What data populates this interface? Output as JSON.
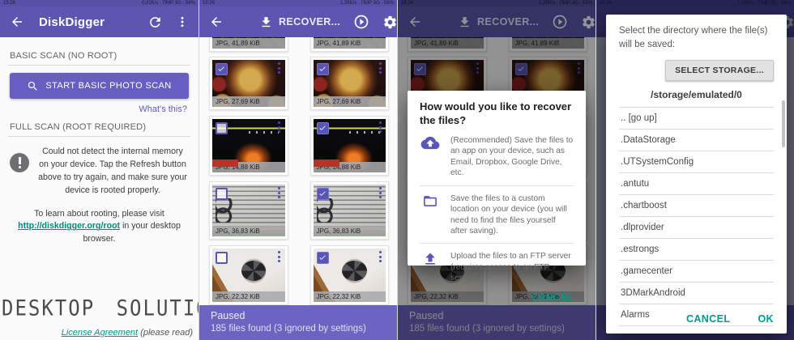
{
  "status": {
    "time": "15:26",
    "right_main": "0,02K/s · ПМР 3G · 58%",
    "right_gallery": "1,35K/s · ПМР 3G · 58%"
  },
  "main_screen": {
    "title": "DiskDigger",
    "basic_header": "BASIC SCAN (NO ROOT)",
    "scan_button": "START BASIC PHOTO SCAN",
    "whats_this": "What's this?",
    "full_header": "FULL SCAN (ROOT REQUIRED)",
    "root_error": "Could not detect the internal memory on your device. Tap the Refresh button above to try again, and make sure your device is rooted properly.",
    "root_info_prefix": "To learn about rooting, please visit ",
    "root_link": "http://diskdigger.org/root",
    "root_info_suffix": " in your desktop browser.",
    "watermark": "DESKTOP SOLUTION",
    "license_link": "License Agreement",
    "license_note": "(please read)"
  },
  "gallery": {
    "recover_label": "RECOVER...",
    "partial_caption": "JPG, 41,89 KiB",
    "rows": [
      {
        "kind": "pizza",
        "caption": "JPG, 27,69 KiB",
        "left_checked": true,
        "right_checked": true
      },
      {
        "kind": "concert",
        "caption": "JPG, 14,88 KiB",
        "left_checked": false,
        "right_checked": true
      },
      {
        "kind": "label",
        "caption": "JPG, 36,83 KiB",
        "left_checked": false,
        "right_checked": true
      },
      {
        "kind": "fan",
        "caption": "JPG, 22,32 KiB",
        "left_checked": false,
        "right_checked": true
      }
    ],
    "status_line1": "Paused",
    "status_line2": "185 files found (3 ignored by settings)"
  },
  "recover_dialog": {
    "title": "How would you like to recover the files?",
    "options": [
      {
        "icon": "cloud-upload-icon",
        "text": "(Recommended) Save the files to an app on your device, such as Email, Dropbox, Google Drive, etc."
      },
      {
        "icon": "folder-icon",
        "text": "Save the files to a custom location on your device (you will need to find the files yourself after saving)."
      },
      {
        "icon": "ftp-upload-icon",
        "text": "Upload the files to an FTP server (requires access to an FTP server)."
      }
    ],
    "cancel": "CANCEL"
  },
  "directory_dialog": {
    "prompt": "Select the directory where the file(s) will be saved:",
    "select_storage": "SELECT STORAGE...",
    "path": "/storage/emulated/0",
    "entries": [
      ".. [go up]",
      ".DataStorage",
      ".UTSystemConfig",
      ".antutu",
      ".chartboost",
      ".dlprovider",
      ".estrongs",
      ".gamecenter",
      "3DMarkAndroid",
      "Alarms"
    ],
    "cancel": "CANCEL",
    "ok": "OK"
  },
  "colors": {
    "toolbar_purple": "#5c56b0",
    "button_purple": "#665fc1",
    "status_bar_purple": "#6b65c1",
    "accent_teal": "#009688",
    "link_purple": "#5f58c0"
  }
}
